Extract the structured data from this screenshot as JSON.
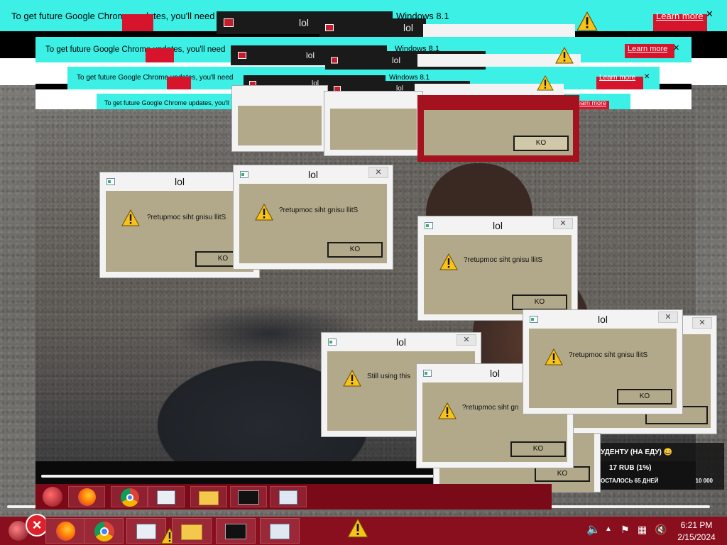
{
  "chrome_update_bar": {
    "message": "To get future Google Chrome updates, you'll need",
    "learn_more": "Learn more",
    "close": "✕",
    "os_fragment": "Windows 8.1"
  },
  "dialog": {
    "title": "lol",
    "message_reversed": "?retupmoc siht gnisu llitS",
    "message_partial": "Still using this",
    "message_cut": "?retupmoc siht gn",
    "ok_reversed": "KO",
    "close": "✕"
  },
  "stream_overlay": {
    "goal_title": "УДЕНТУ (НА ЕДУ) 😀",
    "goal_amount": "17 RUB (1%)",
    "days_left": "ОСТАЛОСЬ 65 ДНЕЙ",
    "goal_target": "10 000"
  },
  "taskbar": {
    "apps": [
      {
        "name": "firefox",
        "label": "Firefox"
      },
      {
        "name": "chrome",
        "label": "Google Chrome"
      },
      {
        "name": "control-panel",
        "label": "Control Panel"
      },
      {
        "name": "file-explorer",
        "label": "File Explorer"
      },
      {
        "name": "command-prompt",
        "label": "Command Prompt"
      },
      {
        "name": "performance-monitor",
        "label": "Performance Monitor"
      }
    ],
    "time": "6:21 PM",
    "date": "2/15/2024"
  },
  "colors": {
    "update_bar": "#3cf0e6",
    "taskbar": "#8a0f1e",
    "dialog_body": "#b2a88a",
    "error_red": "#d6142c"
  }
}
